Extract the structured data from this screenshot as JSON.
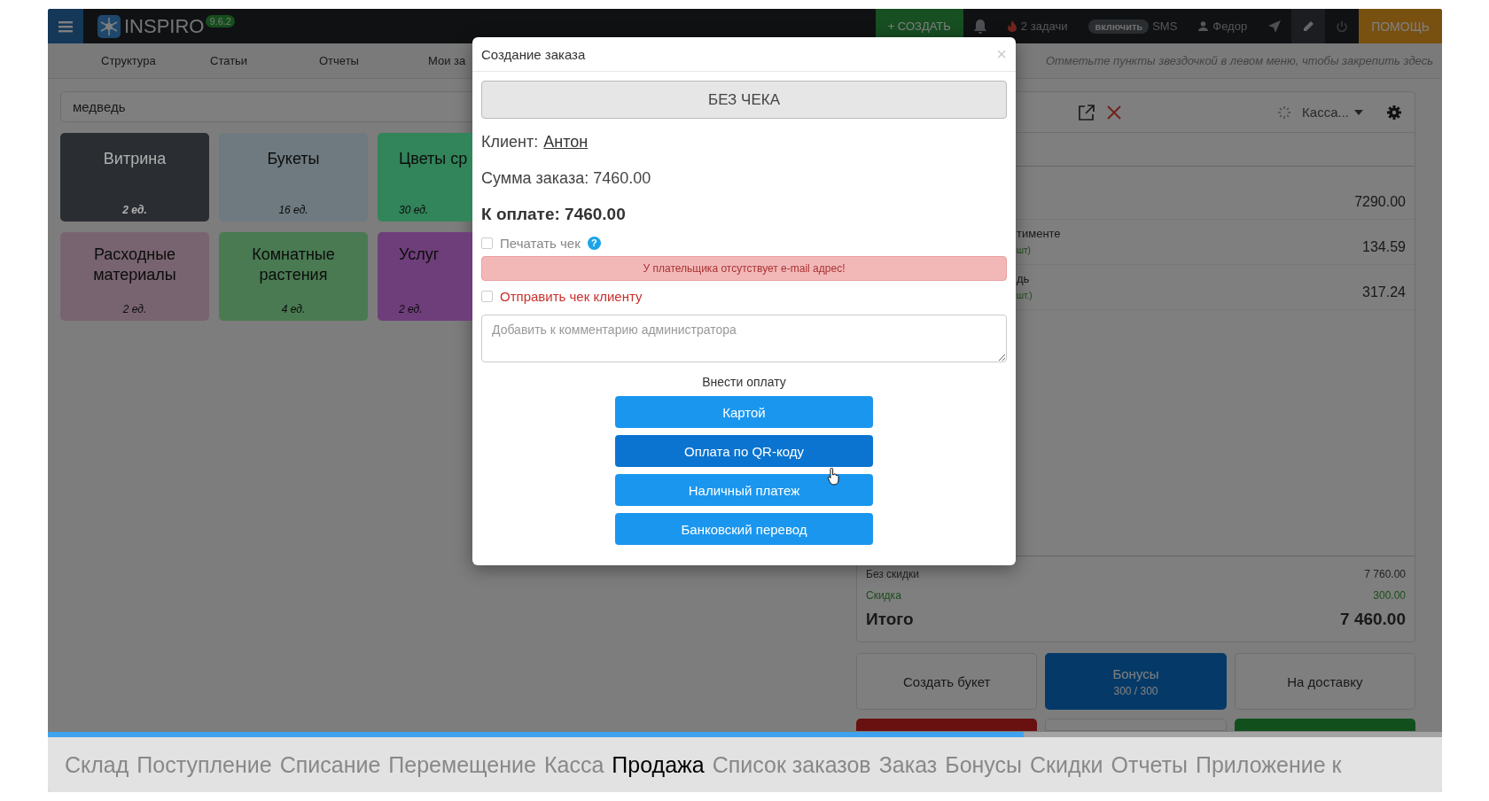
{
  "top_bar": {
    "logo": "INSPIRO",
    "version": "9.6.2",
    "create_button": "+ СОЗДАТЬ",
    "tasks": "2 задачи",
    "sms_toggle": "включить",
    "sms": "SMS",
    "user": "Федор",
    "help_button": "ПОМОЩЬ"
  },
  "nav": {
    "items": [
      "Структура",
      "Статьи",
      "Отчеты",
      "Мои за"
    ],
    "hint": "Отметьте пункты звездочкой в левом меню, чтобы закрепить здесь"
  },
  "search": {
    "value": "медведь"
  },
  "categories": [
    {
      "name": "Витрина",
      "count": "2 ед.",
      "color": "#2a2e33",
      "dark": true
    },
    {
      "name": "Букеты",
      "count": "16 ед.",
      "color": "#6e7a80",
      "dark": false
    },
    {
      "name": "Цветы ср",
      "count": "30 ед.",
      "color": "#32845a",
      "dark": false
    },
    {
      "name": "Расходные материалы",
      "count": "2 ед.",
      "color": "#786470",
      "dark": false
    },
    {
      "name": "Комнатные растения",
      "count": "4 ед.",
      "color": "#4a7a52",
      "dark": false
    },
    {
      "name": "Услуг",
      "count": "2 ед.",
      "color": "#6e3e7a",
      "dark": false
    }
  ],
  "order_panel": {
    "register": "Касса...",
    "rows": [
      {
        "price": "7290.00"
      },
      {
        "name": "тименте",
        "note": "шт)",
        "price": "134.59"
      },
      {
        "name": "дь",
        "note": "шт.)",
        "price": "317.24"
      }
    ],
    "totals": [
      {
        "label": "Без скидки",
        "value": "7 760.00",
        "kind": "plain"
      },
      {
        "label": "Скидка",
        "value": "300.00",
        "kind": "discount"
      },
      {
        "label": "Итого",
        "value": "7 460.00",
        "kind": "total"
      }
    ],
    "buttons": [
      {
        "label": "Создать букет",
        "kind": "plain"
      },
      {
        "label": "Бонусы",
        "sub": "300 / 300",
        "kind": "primary"
      },
      {
        "label": "На доставку",
        "kind": "plain"
      },
      {
        "kind": "danger"
      },
      {
        "kind": "plain"
      },
      {
        "kind": "success"
      }
    ]
  },
  "modal": {
    "title": "Создание заказа",
    "close": "×",
    "receipt_button": "БЕЗ ЧЕКА",
    "client_label": "Клиент:",
    "client": "Антон",
    "sum": "Сумма заказа: 7460.00",
    "to_pay": "К оплате: 7460.00",
    "print_receipt": {
      "label": "Печатать чек",
      "checked": false,
      "disabled": true,
      "help": "?"
    },
    "alert": "У плательщика отсутствует e-mail адрес!",
    "send_receipt": {
      "label": "Отправить чек клиенту",
      "checked": false,
      "disabled": false
    },
    "comment": {
      "placeholder": "Добавить к комментарию администратора"
    },
    "payment_title": "Внести оплату",
    "payment_buttons": [
      {
        "label": "Картой",
        "hovered": false
      },
      {
        "label": "Оплата по QR-коду",
        "hovered": true
      },
      {
        "label": "Наличный платеж",
        "hovered": false
      },
      {
        "label": "Банковский перевод",
        "hovered": false
      }
    ]
  },
  "player": {
    "level": 0.7,
    "chapters": [
      {
        "label": "Склад",
        "selected": false
      },
      {
        "label": "Поступление",
        "selected": false
      },
      {
        "label": "Списание",
        "selected": false
      },
      {
        "label": "Перемещение",
        "selected": false
      },
      {
        "label": "Касса",
        "selected": false
      },
      {
        "label": "Продажа",
        "selected": true
      },
      {
        "label": "Список заказов",
        "selected": false
      },
      {
        "label": "Заказ",
        "selected": false
      },
      {
        "label": "Бонусы",
        "selected": false
      },
      {
        "label": "Скидки",
        "selected": false
      },
      {
        "label": "Отчеты",
        "selected": false
      },
      {
        "label": "Приложение к",
        "selected": false
      }
    ]
  }
}
